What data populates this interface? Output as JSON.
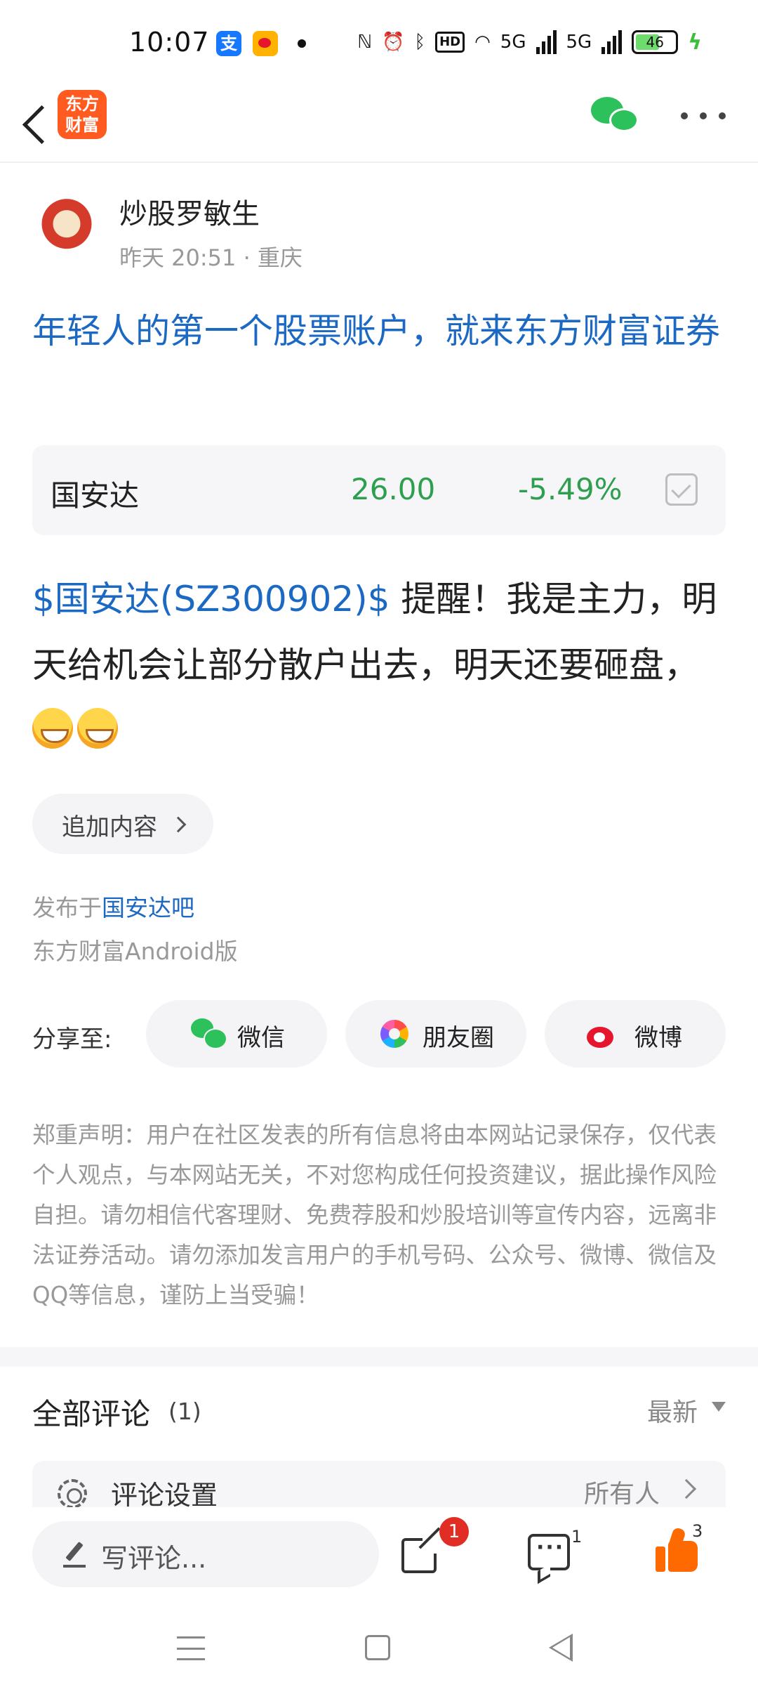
{
  "status_bar": {
    "time": "10:07",
    "alipay_glyph": "支",
    "hd_label": "HD",
    "net1": "5G",
    "net2": "5G",
    "battery": "46"
  },
  "header": {
    "logo_text": "东方财富"
  },
  "post": {
    "author": "炒股罗敏生",
    "meta": "昨天 20:51 · 重庆",
    "title": "年轻人的第一个股票账户，就来东方财富证券",
    "stock": {
      "name": "国安达",
      "price": "26.00",
      "change": "-5.49%"
    },
    "stock_link": "$国安达(SZ300902)$",
    "body": " 提醒！我是主力，明天给机会让部分散户出去，明天还要砸盘，",
    "append_label": "追加内容",
    "published_prefix": "发布于",
    "published_bar": "国安达吧",
    "client": "东方财富Android版"
  },
  "share": {
    "label": "分享至:",
    "wechat": "微信",
    "moments": "朋友圈",
    "weibo": "微博"
  },
  "disclaimer": "郑重声明：用户在社区发表的所有信息将由本网站记录保存，仅代表个人观点，与本网站无关，不对您构成任何投资建议，据此操作风险自担。请勿相信代客理财、免费荐股和炒股培训等宣传内容，远离非法证券活动。请勿添加发言用户的手机号码、公众号、微博、微信及QQ等信息，谨防上当受骗！",
  "comments": {
    "title": "全部评论",
    "count": "(1)",
    "sort": "最新",
    "settings_label": "评论设置",
    "settings_value": "所有人"
  },
  "action_bar": {
    "placeholder": "写评论...",
    "share_badge": "1",
    "comment_count": "1",
    "like_count": "3"
  },
  "colors": {
    "link_blue": "#1c69c4",
    "down_green": "#2e9e4f",
    "brand_orange": "#ff5a1f",
    "like_orange": "#ff6a00",
    "badge_red": "#e02e24"
  }
}
